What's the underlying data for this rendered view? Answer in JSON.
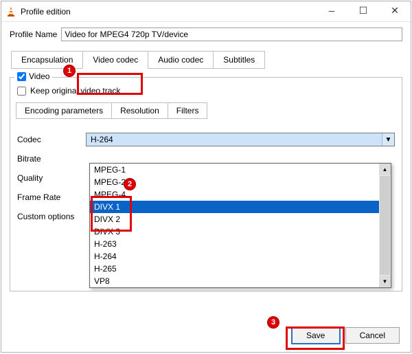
{
  "window": {
    "title": "Profile edition"
  },
  "profileName": {
    "label": "Profile Name",
    "value": "Video for MPEG4 720p TV/device"
  },
  "tabs": {
    "encapsulation": "Encapsulation",
    "videoCodec": "Video codec",
    "audioCodec": "Audio codec",
    "subtitles": "Subtitles"
  },
  "videoGroup": {
    "videoLabel": "Video",
    "keepOriginal": "Keep original video track"
  },
  "subtabs": {
    "encoding": "Encoding parameters",
    "resolution": "Resolution",
    "filters": "Filters"
  },
  "form": {
    "codec": "Codec",
    "bitrate": "Bitrate",
    "quality": "Quality",
    "frameRate": "Frame Rate",
    "custom": "Custom options"
  },
  "codecCombo": {
    "selected": "H-264"
  },
  "dropdown": {
    "items": [
      "MPEG-1",
      "MPEG-2",
      "MPEG-4",
      "DIVX 1",
      "DIVX 2",
      "DIVX 3",
      "H-263",
      "H-264",
      "H-265",
      "VP8"
    ]
  },
  "buttons": {
    "save": "Save",
    "cancel": "Cancel"
  },
  "markers": {
    "m1": "1",
    "m2": "2",
    "m3": "3"
  },
  "glyphs": {
    "arrowDown": "▼",
    "arrowUp": "▲",
    "minimize": "—",
    "maximize": "☐",
    "close": "✕"
  }
}
